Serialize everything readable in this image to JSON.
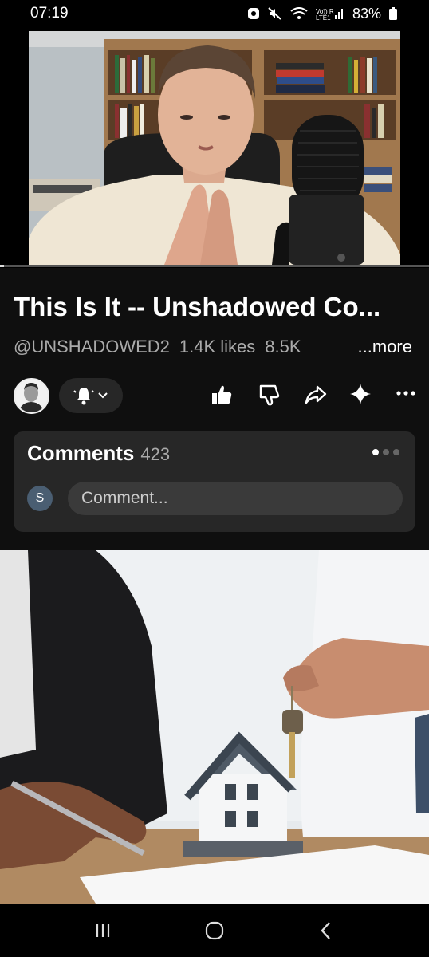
{
  "status_bar": {
    "time": "07:19",
    "network_label": "Vo)) R\nLTE1",
    "battery": "83%"
  },
  "video": {
    "progress_fraction": 0.01
  },
  "info": {
    "title": "This Is It -- Unshadowed Co...",
    "channel": "@UNSHADOWED2",
    "likes": "1.4K likes",
    "views": "8.5K",
    "more": "...more"
  },
  "actions": {
    "icons": [
      "channel-avatar",
      "bell-icon",
      "thumbs-up-icon",
      "thumbs-down-icon",
      "share-icon",
      "sparkle-icon",
      "more-icon"
    ]
  },
  "comments": {
    "title": "Comments",
    "count": "423",
    "avatar_letter": "S",
    "placeholder": "Comment..."
  },
  "colors": {
    "background": "#0f0f0f",
    "card": "#272727",
    "secondary_text": "#aaaaaa"
  }
}
